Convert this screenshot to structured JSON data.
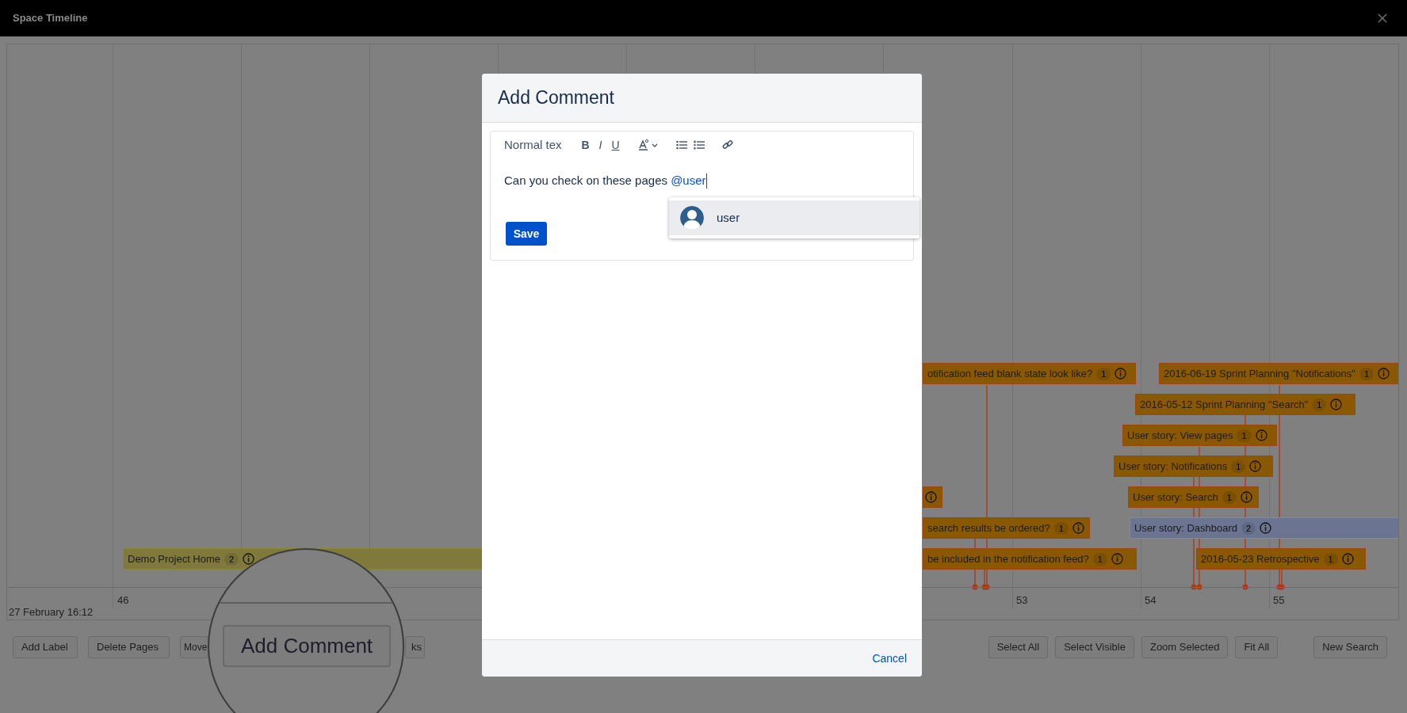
{
  "window": {
    "title": "Space Timeline"
  },
  "timeline": {
    "week_labels": [
      "46",
      "53",
      "54",
      "55"
    ],
    "date_label": "27 February 16:12",
    "items": [
      {
        "label": "otification feed blank state look like?",
        "count": "1",
        "color": "#8a5800"
      },
      {
        "label": "2016-06-19 Sprint Planning \"Notifications\"",
        "count": "1",
        "color": "#8a5800"
      },
      {
        "label": "2016-05-12 Sprint Planning \"Search\"",
        "count": "1",
        "color": "#8a5800"
      },
      {
        "label": "User story: View pages",
        "count": "1",
        "color": "#8a5800"
      },
      {
        "label": "User story: Notifications",
        "count": "1",
        "color": "#8a5800"
      },
      {
        "color": "#8a5800"
      },
      {
        "label": "User story: Search",
        "count": "1",
        "color": "#8a5800"
      },
      {
        "label": "search results be ordered?",
        "count": "1",
        "color": "#8a5800"
      },
      {
        "label": "User story: Dashboard",
        "count": "2",
        "color": "#6b7591"
      },
      {
        "label": "Demo Project Home",
        "count": "2",
        "color": "#7f793c"
      },
      {
        "label": "be included in the notification feed?",
        "count": "1",
        "color": "#8a5800"
      },
      {
        "label": "2016-05-23 Retrospective",
        "count": "1",
        "color": "#8a5800"
      }
    ]
  },
  "toolbar_left": [
    "Add Label",
    "Delete Pages",
    "Move",
    "ks"
  ],
  "toolbar_right": [
    "Select All",
    "Select Visible",
    "Zoom Selected",
    "Fit All",
    "New Search"
  ],
  "magnifier": {
    "button": "Add Comment"
  },
  "dialog": {
    "title": "Add Comment",
    "style_menu": "Normal tex",
    "format_buttons": [
      "B",
      "I",
      "U"
    ],
    "text": "Can you check on these pages ",
    "mention": "@user",
    "save": "Save",
    "suggestions": [
      {
        "name": "user",
        "selected": true
      }
    ],
    "cancel": "Cancel"
  }
}
